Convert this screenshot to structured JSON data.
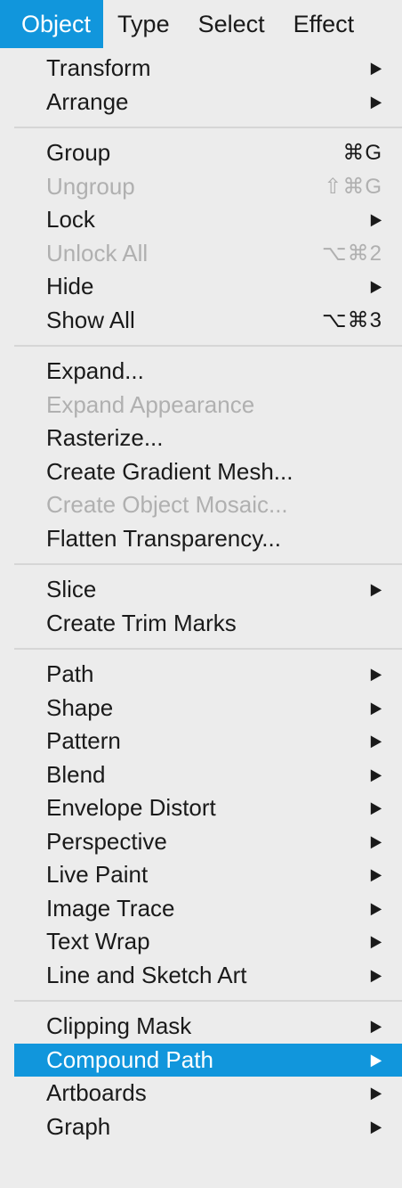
{
  "menubar": {
    "items": [
      "Object",
      "Type",
      "Select",
      "Effect"
    ]
  },
  "menu": {
    "transform": {
      "label": "Transform",
      "arrow": "▶"
    },
    "arrange": {
      "label": "Arrange",
      "arrow": "▶"
    },
    "group": {
      "label": "Group",
      "shortcut": "⌘G"
    },
    "ungroup": {
      "label": "Ungroup",
      "shortcut": "⇧⌘G"
    },
    "lock": {
      "label": "Lock",
      "arrow": "▶"
    },
    "unlock_all": {
      "label": "Unlock All",
      "shortcut": "⌥⌘2"
    },
    "hide": {
      "label": "Hide",
      "arrow": "▶"
    },
    "show_all": {
      "label": "Show All",
      "shortcut": "⌥⌘3"
    },
    "expand": {
      "label": "Expand..."
    },
    "expand_appearance": {
      "label": "Expand Appearance"
    },
    "rasterize": {
      "label": "Rasterize..."
    },
    "create_gradient_mesh": {
      "label": "Create Gradient Mesh..."
    },
    "create_object_mosaic": {
      "label": "Create Object Mosaic..."
    },
    "flatten_transparency": {
      "label": "Flatten Transparency..."
    },
    "slice": {
      "label": "Slice",
      "arrow": "▶"
    },
    "create_trim_marks": {
      "label": "Create Trim Marks"
    },
    "path": {
      "label": "Path",
      "arrow": "▶"
    },
    "shape": {
      "label": "Shape",
      "arrow": "▶"
    },
    "pattern": {
      "label": "Pattern",
      "arrow": "▶"
    },
    "blend": {
      "label": "Blend",
      "arrow": "▶"
    },
    "envelope_distort": {
      "label": "Envelope Distort",
      "arrow": "▶"
    },
    "perspective": {
      "label": "Perspective",
      "arrow": "▶"
    },
    "live_paint": {
      "label": "Live Paint",
      "arrow": "▶"
    },
    "image_trace": {
      "label": "Image Trace",
      "arrow": "▶"
    },
    "text_wrap": {
      "label": "Text Wrap",
      "arrow": "▶"
    },
    "line_and_sketch_art": {
      "label": "Line and Sketch Art",
      "arrow": "▶"
    },
    "clipping_mask": {
      "label": "Clipping Mask",
      "arrow": "▶"
    },
    "compound_path": {
      "label": "Compound Path",
      "arrow": "▶"
    },
    "artboards": {
      "label": "Artboards",
      "arrow": "▶"
    },
    "graph": {
      "label": "Graph",
      "arrow": "▶"
    }
  },
  "colors": {
    "highlight": "#1196dc",
    "disabled_text": "#b0b0b0",
    "background": "#ececec"
  }
}
